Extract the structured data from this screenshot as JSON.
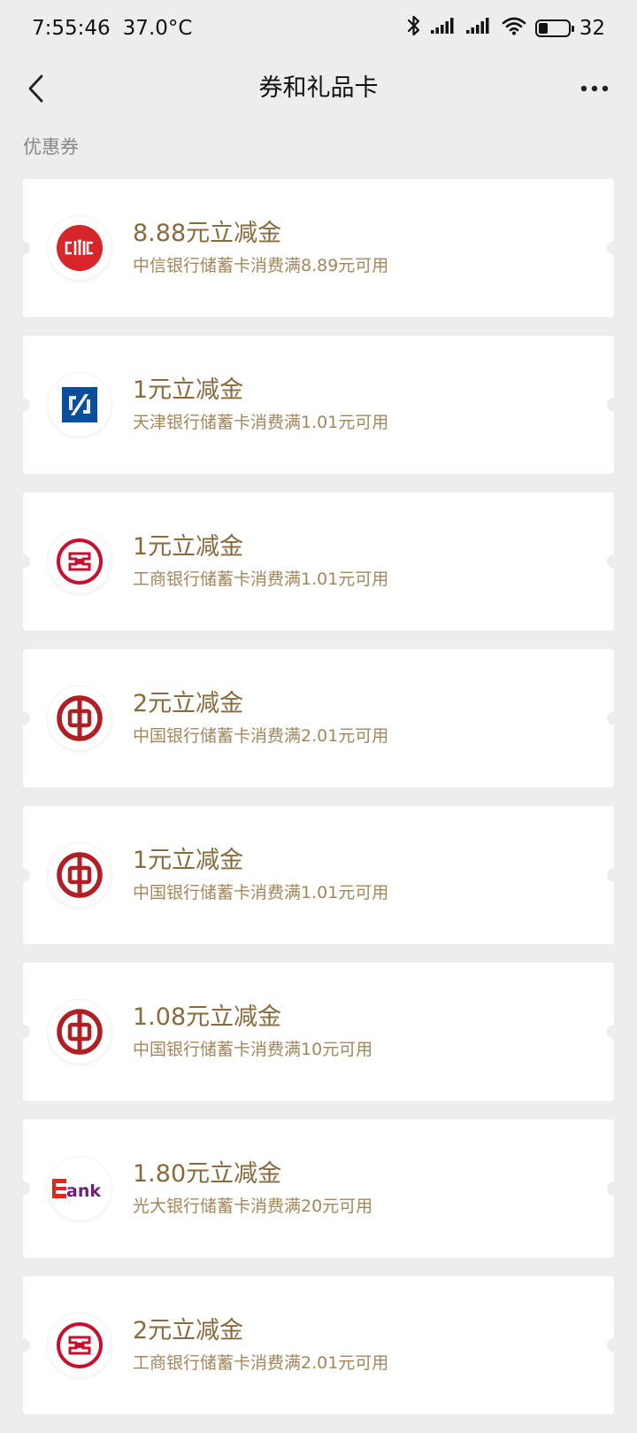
{
  "status": {
    "time": "7:55:46",
    "temperature": "37.0°C",
    "battery": "32",
    "battery_level": 0.32
  },
  "nav": {
    "title": "券和礼品卡"
  },
  "section": {
    "label": "优惠券"
  },
  "coupons": [
    {
      "bank": "citic",
      "amount": "8.88元立减金",
      "desc": "中信银行储蓄卡消费满8.89元可用"
    },
    {
      "bank": "tianjin",
      "amount": "1元立减金",
      "desc": "天津银行储蓄卡消费满1.01元可用"
    },
    {
      "bank": "icbc",
      "amount": "1元立减金",
      "desc": "工商银行储蓄卡消费满1.01元可用"
    },
    {
      "bank": "boc",
      "amount": "2元立减金",
      "desc": "中国银行储蓄卡消费满2.01元可用"
    },
    {
      "bank": "boc",
      "amount": "1元立减金",
      "desc": "中国银行储蓄卡消费满1.01元可用"
    },
    {
      "bank": "boc",
      "amount": "1.08元立减金",
      "desc": "中国银行储蓄卡消费满10元可用"
    },
    {
      "bank": "ceb",
      "amount": "1.80元立减金",
      "desc": "光大银行储蓄卡消费满20元可用",
      "logo_text": "Bank"
    },
    {
      "bank": "icbc",
      "amount": "2元立减金",
      "desc": "工商银行储蓄卡消费满2.01元可用"
    }
  ],
  "colors": {
    "background": "#ededed",
    "amount_text": "#8a6a3c",
    "desc_text": "#a3875b",
    "citic_red": "#d7262a",
    "icbc_red": "#c8102e",
    "boc_red": "#b01f24",
    "tianjin_blue": "#0b4f9c",
    "ceb_red": "#e2261a",
    "ceb_purple": "#6d2077"
  }
}
